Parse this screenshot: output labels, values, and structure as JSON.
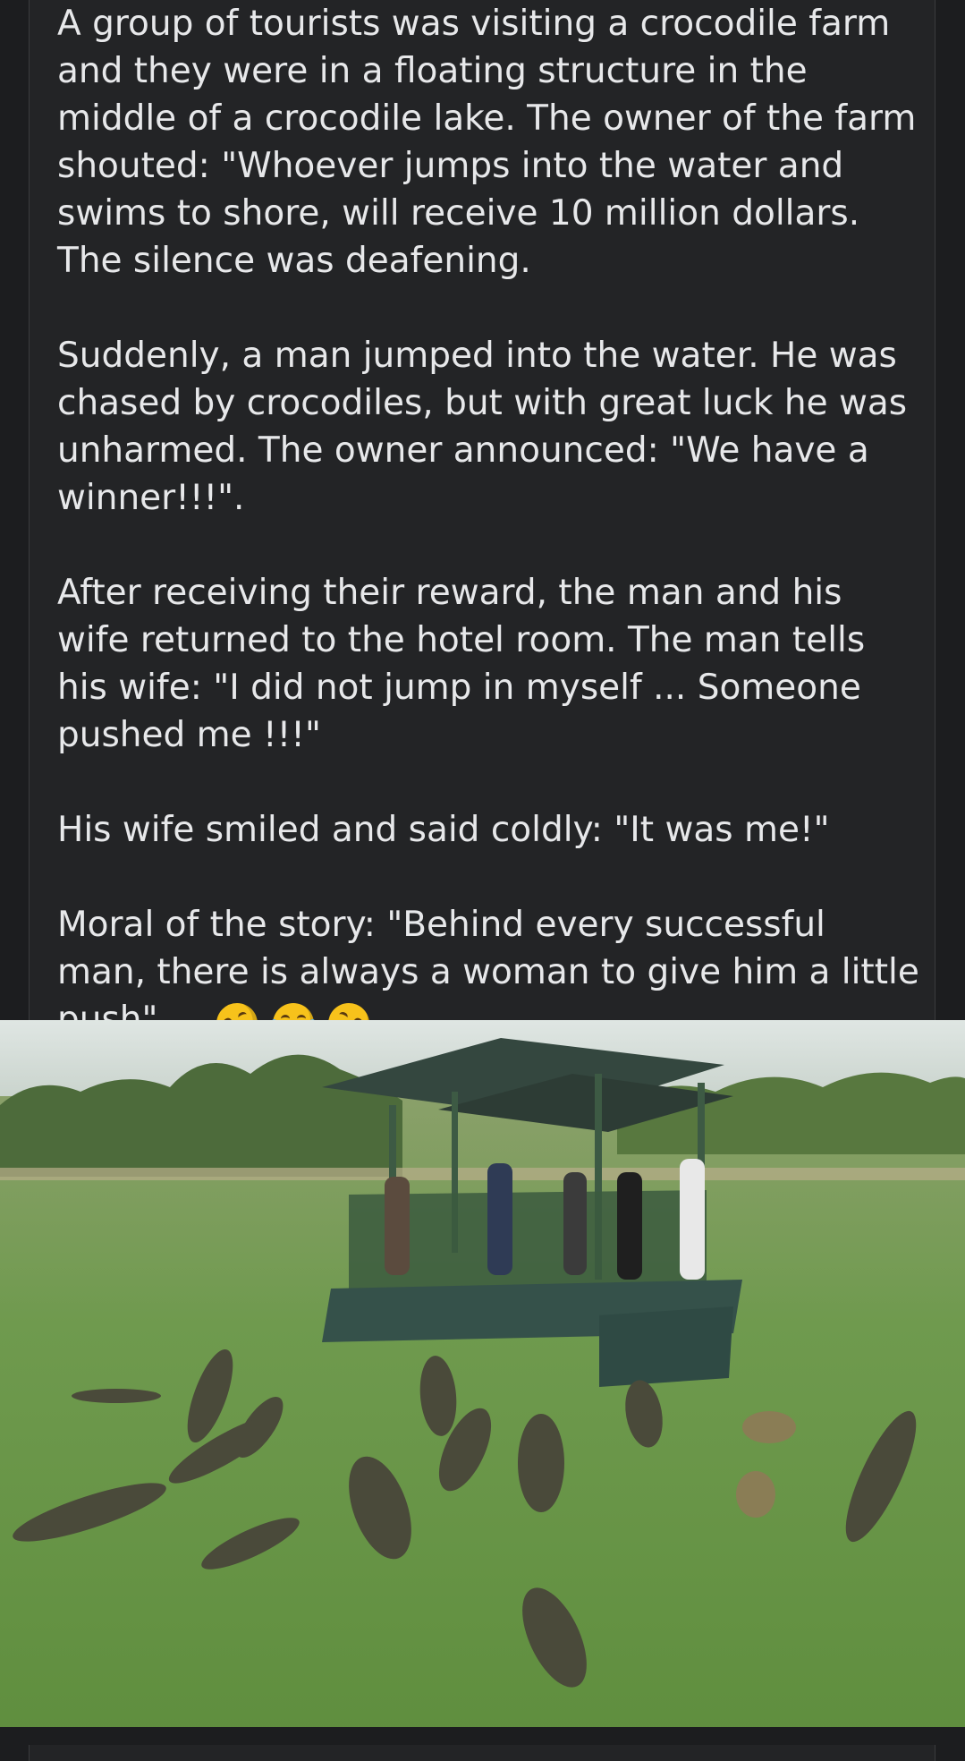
{
  "post": {
    "paragraphs": [
      "A group of tourists was visiting a crocodile farm and they were in a floating structure in the middle of a crocodile lake. The owner of the farm shouted: \"Whoever jumps into the water and swims to shore, will receive 10 million dollars. The silence was deafening.",
      "Suddenly, a man jumped into the water. He was chased by crocodiles, but with great luck he was unharmed. The owner announced: \"We have a winner!!!\".",
      "After receiving their reward, the man and his wife returned to the hotel room. The man tells his wife: \"I did not jump in myself ... Someone pushed me !!!\"",
      "His wife smiled and said coldly: \"It was me!\""
    ],
    "moral_text": "Moral of the story: \"Behind every successful man, there is always a woman to give him a little push\" ...",
    "emojis": [
      "rolling-on-floor-laughing",
      "tears-of-joy",
      "rolling-on-floor-laughing"
    ]
  },
  "colors": {
    "background": "#1c1d1f",
    "card": "#232426",
    "text": "#e7e8ea"
  }
}
